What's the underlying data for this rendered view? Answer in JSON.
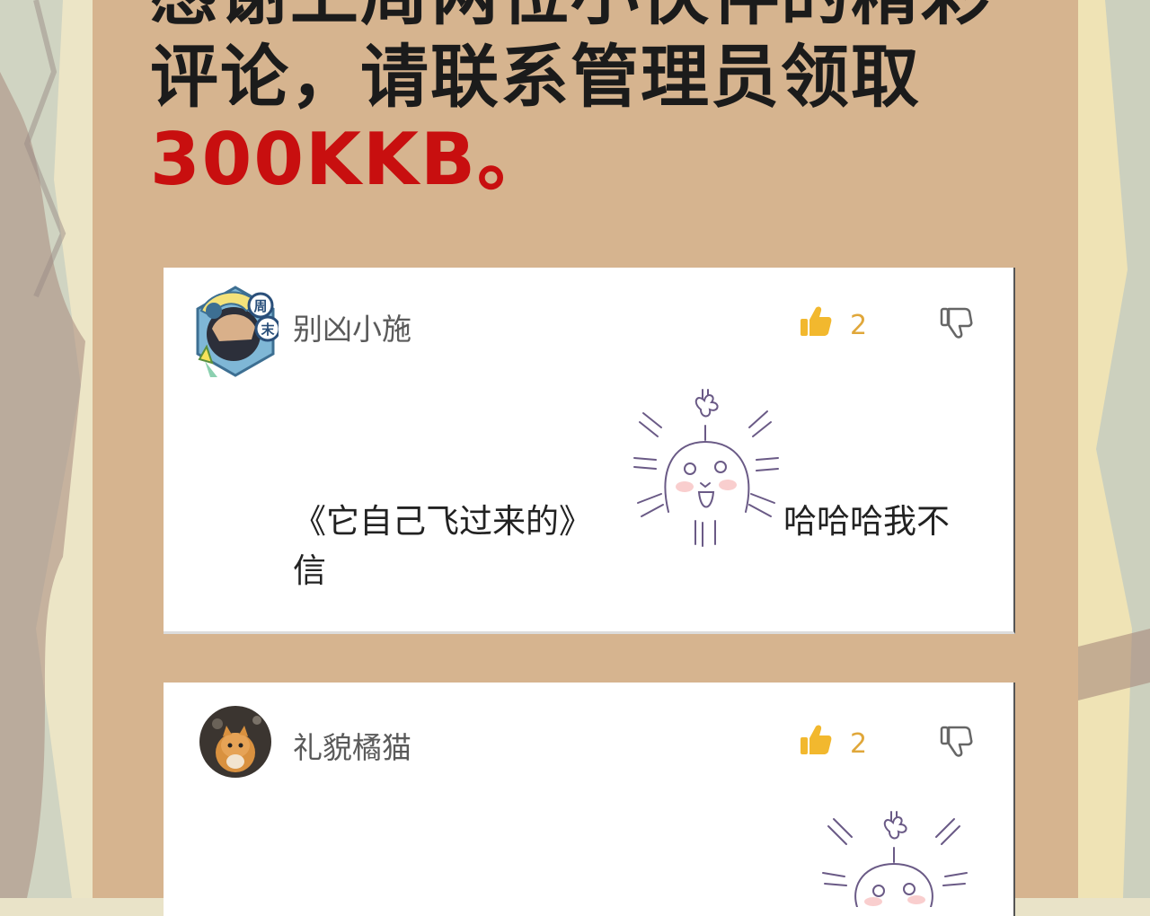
{
  "headline": {
    "line1": "感谢上周两位小伙伴的精彩",
    "line2": "评论，请联系管理员领取",
    "line3": "300KKB。"
  },
  "comments": [
    {
      "username": "别凶小施",
      "avatar_badge": [
        "周",
        "末"
      ],
      "likes": "2",
      "text_before": "《它自己飞过来的》",
      "text_after": "哈哈哈我不",
      "text_wrap": "信",
      "sticker": "crying-blob-sticker"
    },
    {
      "username": "礼貌橘猫",
      "likes": "2",
      "sticker": "crying-blob-sticker"
    }
  ],
  "colors": {
    "panel": "#d6b48f",
    "accent_red": "#c80f0f",
    "like_yellow": "#f2b82e",
    "like_count": "#e0a73a"
  }
}
